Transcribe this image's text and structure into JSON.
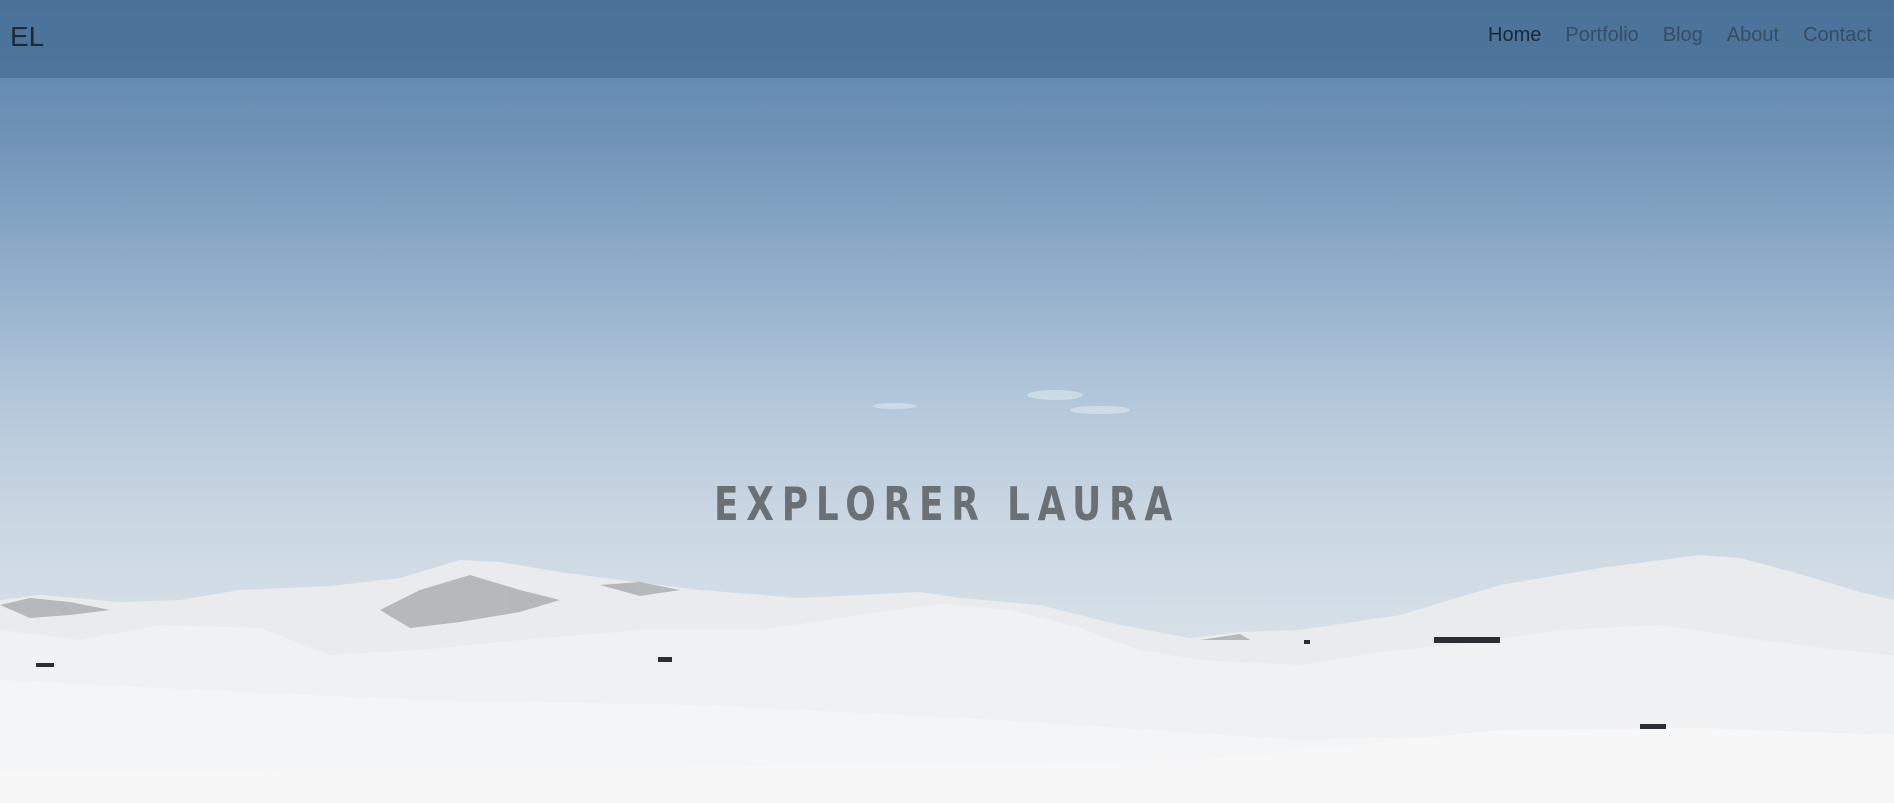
{
  "brand": {
    "logo_text": "EL"
  },
  "nav": {
    "items": [
      {
        "label": "Home",
        "active": true
      },
      {
        "label": "Portfolio",
        "active": false
      },
      {
        "label": "Blog",
        "active": false
      },
      {
        "label": "About",
        "active": false
      },
      {
        "label": "Contact",
        "active": false
      }
    ]
  },
  "hero": {
    "title": "EXPLORER LAURA",
    "background_description_colors": {
      "sky_top": "#5b83a8",
      "sky_bottom": "#d7e0e8",
      "snow": "#f2f3f4"
    }
  }
}
